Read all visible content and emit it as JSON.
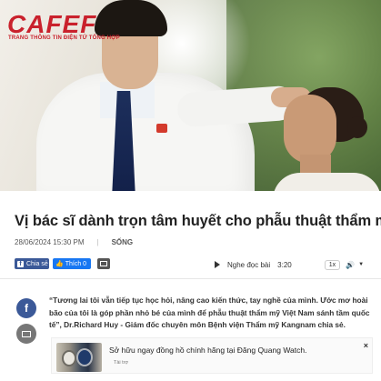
{
  "header": {
    "logo_word": "CAFEF",
    "logo_tagline": "TRANG THÔNG TIN ĐIỆN TỬ TỔNG HỢP"
  },
  "article": {
    "title": "Vị bác sĩ dành trọn tâm huyết cho phẫu thuật thẩm mỹ",
    "datetime": "28/06/2024 15:30 PM",
    "category": "SỐNG",
    "lead": "“Tương lai tôi vẫn tiếp tục học hỏi, nâng cao kiến thức, tay nghề của mình. Ước mơ hoài bão của tôi là góp phần nhỏ bé của mình để phẫu thuật thẩm mỹ Việt Nam sánh tầm quốc tế”, Dr.Richard Huy - Giám đốc chuyên môn Bệnh viện Thẩm mỹ Kangnam chia sẻ."
  },
  "share": {
    "fb_share_label": "Chia sẻ",
    "fb_like_label": "Thích 0",
    "side_fb_glyph": "f"
  },
  "audio": {
    "label": "Nghe đọc bài",
    "duration": "3:20",
    "speed": "1x"
  },
  "ad": {
    "title": "Sở hữu ngay đồng hồ chính hãng tại Đăng Quang Watch.",
    "sponsor_label": "Tài trợ",
    "close_glyph": "×"
  },
  "colors": {
    "brand_red": "#c9212c",
    "facebook_blue": "#3b5998",
    "like_blue": "#1877f2"
  },
  "icons": [
    "facebook-icon",
    "thumbs-up-icon",
    "mail-icon",
    "play-icon",
    "volume-icon",
    "chevron-down-icon",
    "close-icon"
  ]
}
